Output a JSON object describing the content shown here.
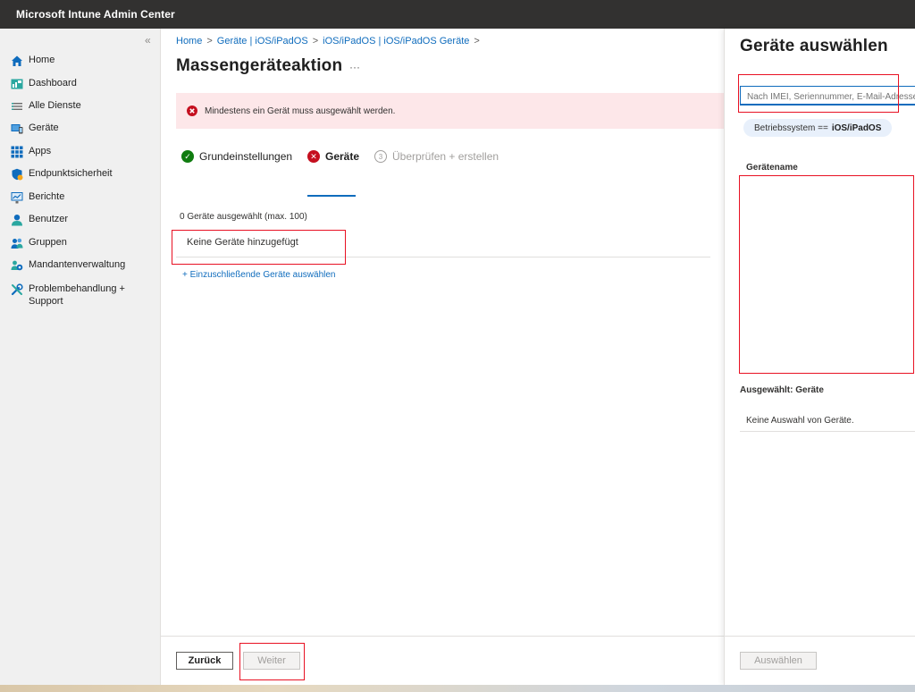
{
  "app": {
    "title": "Microsoft Intune Admin Center"
  },
  "sidebar": {
    "collapse_glyph": "«",
    "items": [
      {
        "label": "Home",
        "icon": "home-icon"
      },
      {
        "label": "Dashboard",
        "icon": "dashboard-icon"
      },
      {
        "label": "Alle Dienste",
        "icon": "list-icon"
      },
      {
        "label": "Geräte",
        "icon": "devices-icon"
      },
      {
        "label": "Apps",
        "icon": "apps-grid-icon"
      },
      {
        "label": "Endpunktsicherheit",
        "icon": "shield-icon"
      },
      {
        "label": "Berichte",
        "icon": "reports-icon"
      },
      {
        "label": "Benutzer",
        "icon": "user-icon"
      },
      {
        "label": "Gruppen",
        "icon": "group-icon"
      },
      {
        "label": "Mandantenverwaltung",
        "icon": "tenant-icon"
      },
      {
        "label": "Problembehandlung +\nSupport",
        "icon": "tools-icon"
      }
    ]
  },
  "main": {
    "breadcrumb": [
      "Home",
      "Geräte | iOS/iPadOS",
      "iOS/iPadOS | iOS/iPadOS Geräte"
    ],
    "breadcrumb_sep": ">",
    "title": "Massengeräteaktion",
    "more_glyph": "···",
    "error_message": "Mindestens ein Gerät muss ausgewählt werden.",
    "steps": [
      {
        "label": "Grundeinstellungen",
        "state": "done",
        "marker": "✓"
      },
      {
        "label": "Geräte",
        "state": "error",
        "marker": "✕"
      },
      {
        "label": "Überprüfen + erstellen",
        "state": "pending",
        "marker": "3"
      }
    ],
    "selected_count": "0 Geräte ausgewählt (max. 100)",
    "no_devices": "Keine Geräte hinzugefügt",
    "add_link": "+ Einzuschließende Geräte auswählen",
    "back_button": "Zurück",
    "next_button": "Weiter"
  },
  "panel": {
    "title": "Geräte auswählen",
    "search_placeholder": "Nach IMEI, Seriennummer, E-Mail-Adresse",
    "filter_prefix": "Betriebssystem ==",
    "filter_value": "iOS/iPadOS",
    "column_header": "Gerätename",
    "selected_header": "Ausgewählt: Geräte",
    "selected_none": "Keine Auswahl von Geräte.",
    "select_button": "Auswählen"
  },
  "colors": {
    "accent": "#0f6cbd",
    "error": "#c50f1f",
    "success": "#107c10",
    "highlight_box": "#e81123"
  }
}
